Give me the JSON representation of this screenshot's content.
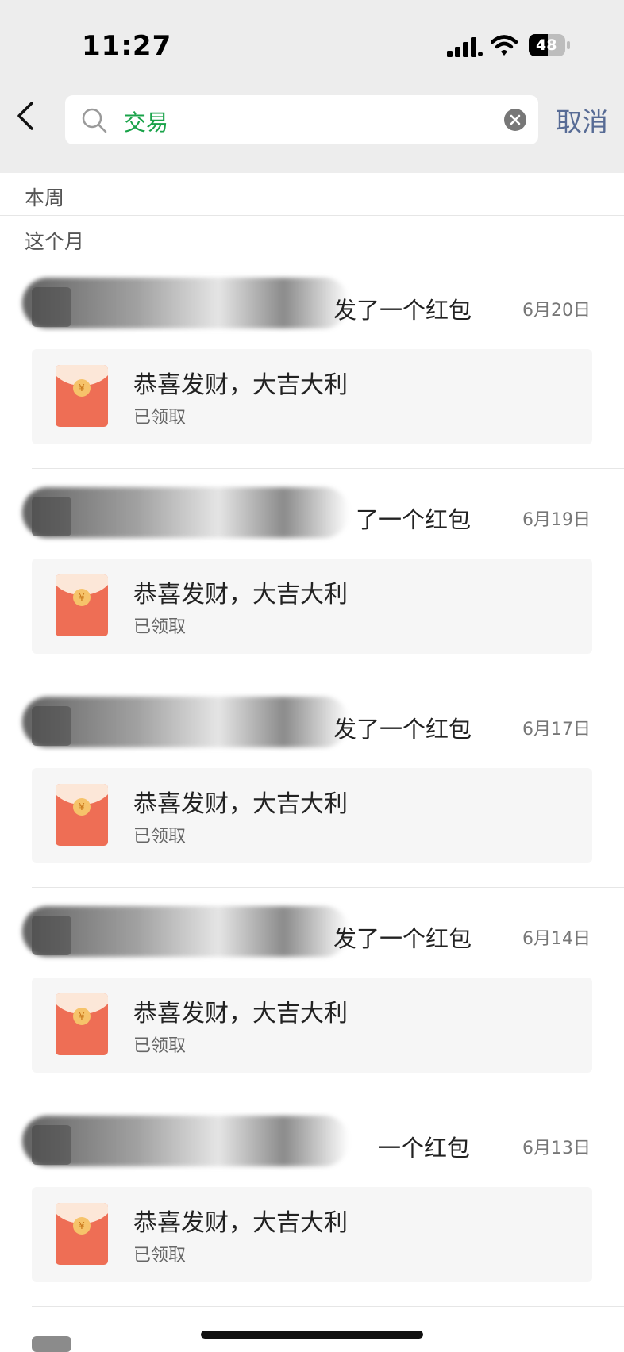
{
  "status_bar": {
    "time": "11:27",
    "battery": "48"
  },
  "search": {
    "query": "交易",
    "cancel_label": "取消"
  },
  "sections": {
    "this_week": "本周",
    "this_month": "这个月"
  },
  "items": [
    {
      "title_visible": "发了一个红包",
      "date": "6月20日",
      "greeting": "恭喜发财，大吉大利",
      "status": "已领取"
    },
    {
      "title_visible": "了一个红包",
      "date": "6月19日",
      "greeting": "恭喜发财，大吉大利",
      "status": "已领取"
    },
    {
      "title_visible": "发了一个红包",
      "date": "6月17日",
      "greeting": "恭喜发财，大吉大利",
      "status": "已领取"
    },
    {
      "title_visible": "发了一个红包",
      "date": "6月14日",
      "greeting": "恭喜发财，大吉大利",
      "status": "已领取"
    },
    {
      "title_visible": "一个红包",
      "date": "6月13日",
      "greeting": "恭喜发财，大吉大利",
      "status": "已领取"
    }
  ],
  "colors": {
    "accent_green": "#1aa34a",
    "link_blue": "#576b95",
    "red_packet": "#ee6e55"
  }
}
